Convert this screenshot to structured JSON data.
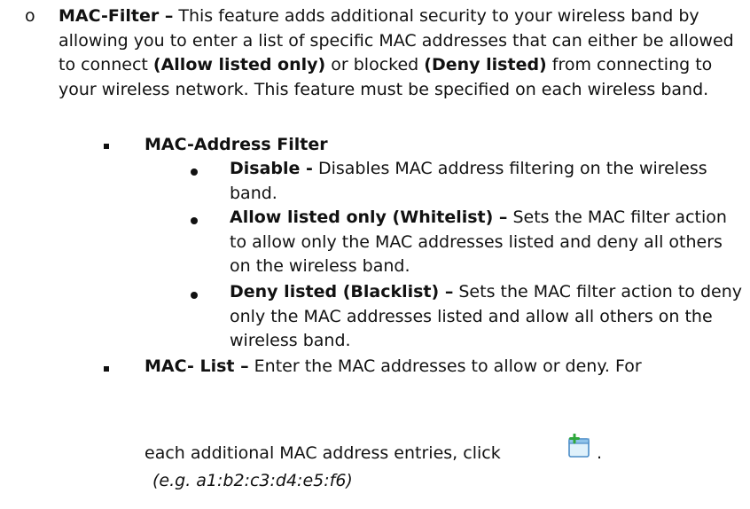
{
  "section": {
    "bullet": "o",
    "title": "MAC-Filter –",
    "intro_part1": " This feature adds additional security to your wireless band by allowing you to enter a list of specific MAC addresses that can either be allowed to connect ",
    "allow_label": "(Allow listed only)",
    "intro_part2": " or blocked ",
    "deny_label": "(Deny listed)",
    "intro_part3": " from connecting to your wireless network. This feature must be specified on each wireless band."
  },
  "mac_address_filter": {
    "heading": "MAC-Address Filter",
    "options": [
      {
        "label": "Disable -",
        "desc": " Disables MAC address filtering on the wireless band."
      },
      {
        "label": "Allow listed only (Whitelist) –",
        "desc": " Sets the MAC filter action to allow only the MAC addresses listed and deny all others on the wireless band."
      },
      {
        "label": "Deny listed (Blacklist) –",
        "desc": " Sets the MAC filter action to deny only the MAC addresses listed and allow all others on the wireless band."
      }
    ]
  },
  "mac_list": {
    "heading": "MAC- List –",
    "desc_line1": " Enter the MAC addresses to allow or deny. For",
    "desc_line2": "each additional MAC address entries, click",
    "period": ".",
    "example": "(e.g. a1:b2:c3:d4:e5:f6)",
    "icon": "add-entry-icon"
  },
  "colors": {
    "text": "#111111",
    "icon_fill": "#dff1fb",
    "icon_border": "#4a8cc7",
    "icon_plus": "#2fa83b"
  }
}
